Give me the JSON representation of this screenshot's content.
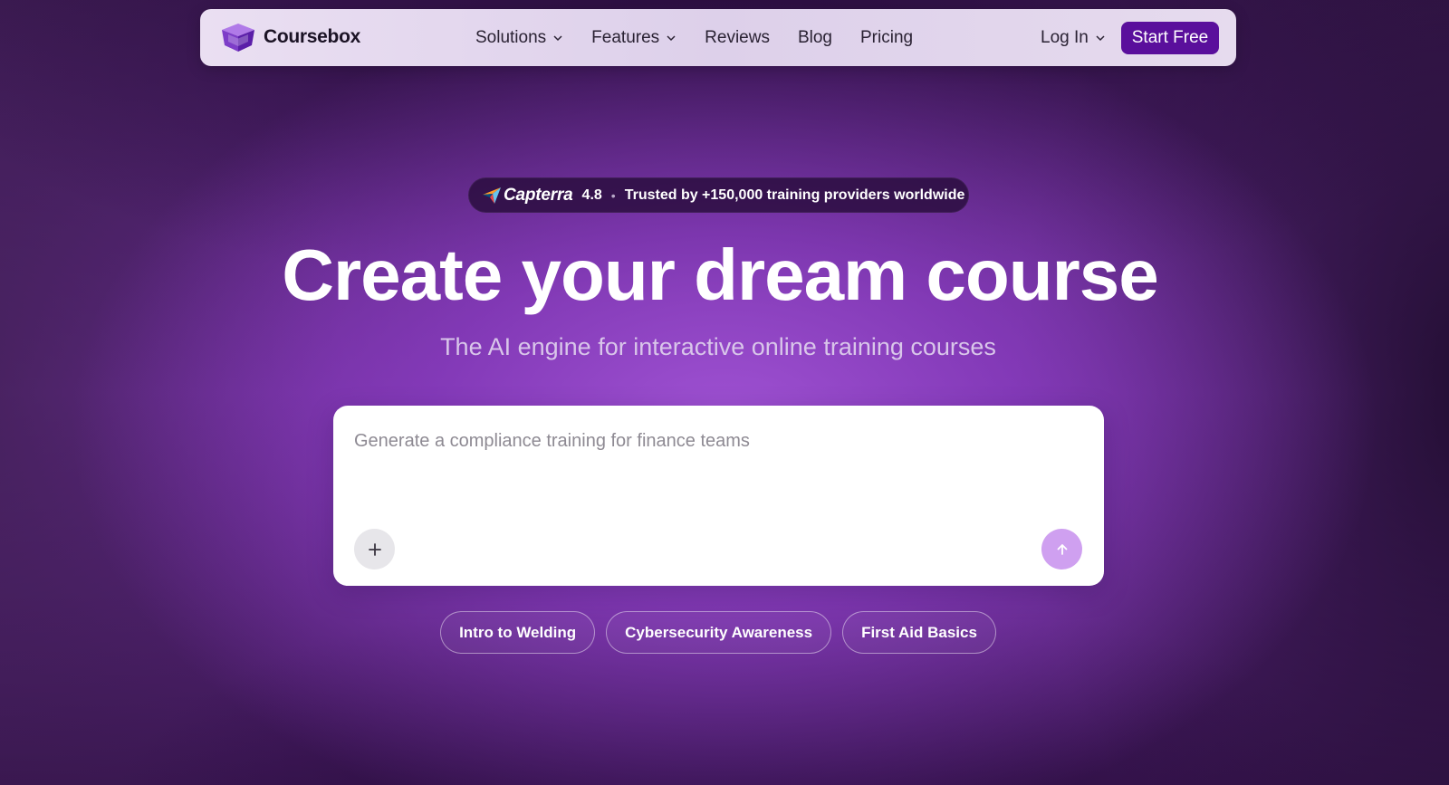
{
  "brand": {
    "name": "Coursebox",
    "accent": "#5a0f9c"
  },
  "nav": {
    "items": [
      {
        "label": "Solutions",
        "dropdown": true
      },
      {
        "label": "Features",
        "dropdown": true
      },
      {
        "label": "Reviews",
        "dropdown": false
      },
      {
        "label": "Blog",
        "dropdown": false
      },
      {
        "label": "Pricing",
        "dropdown": false
      }
    ],
    "login_label": "Log In",
    "cta_label": "Start Free"
  },
  "badge": {
    "platform": "Capterra",
    "rating": "4.8",
    "separator": "•",
    "text": "Trusted by +150,000 training providers worldwide"
  },
  "hero": {
    "title": "Create your dream course",
    "subtitle": "The AI engine for interactive online training courses"
  },
  "prompt": {
    "placeholder": "Generate a compliance training for finance teams",
    "add_icon": "plus-icon",
    "send_icon": "arrow-up-icon"
  },
  "suggestions": [
    {
      "label": "Intro to Welding"
    },
    {
      "label": "Cybersecurity Awareness"
    },
    {
      "label": "First Aid Basics"
    }
  ]
}
